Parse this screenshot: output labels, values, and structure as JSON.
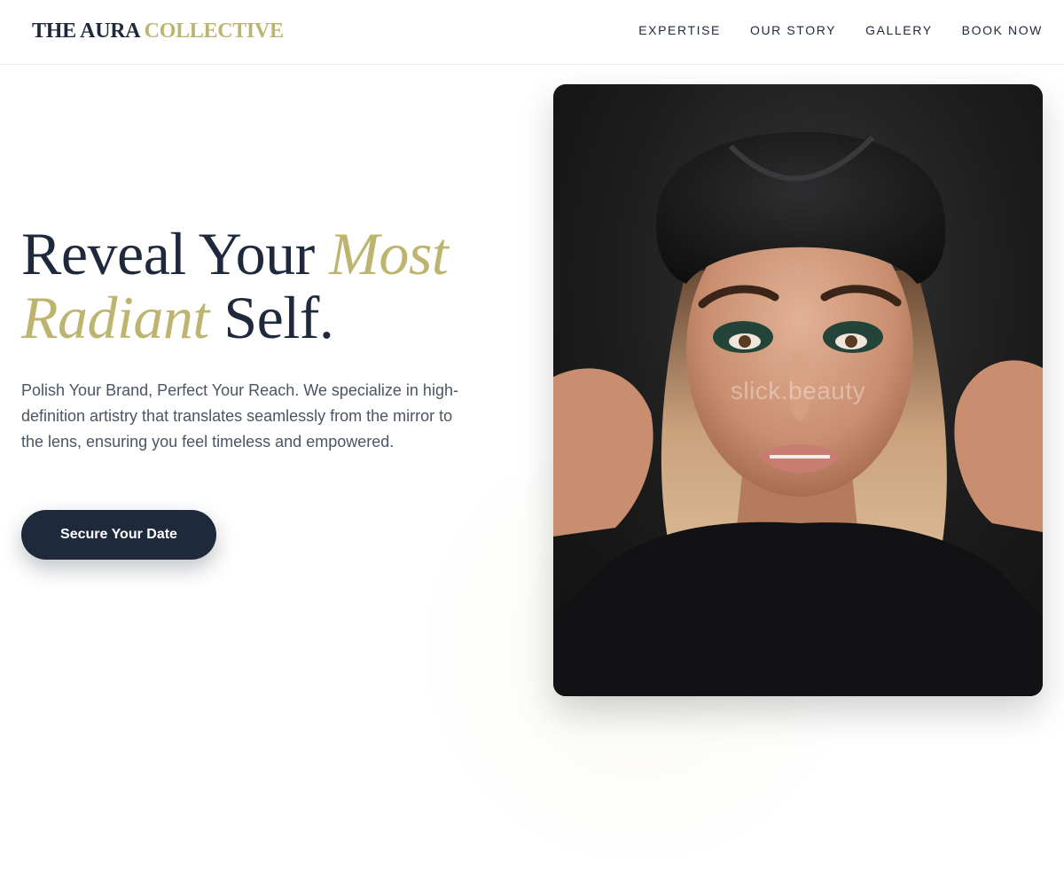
{
  "brand": {
    "name_primary": "THE AURA",
    "name_accent": "COLLECTIVE"
  },
  "nav": {
    "items": [
      {
        "label": "EXPERTISE"
      },
      {
        "label": "OUR STORY"
      },
      {
        "label": "GALLERY"
      },
      {
        "label": "BOOK NOW"
      }
    ]
  },
  "hero": {
    "headline_1": "Reveal Your",
    "headline_accent_1": "Most",
    "headline_accent_2": "Radiant",
    "headline_2": "Self.",
    "lead": "Polish Your Brand, Perfect Your Reach. We specialize in high-definition artistry that translates seamlessly from the mirror to the lens, ensuring you feel timeless and empowered.",
    "cta_label": "Secure Your Date"
  },
  "image": {
    "watermark": "slick.beauty"
  },
  "colors": {
    "primary": "#1e293b",
    "accent": "#bdb56f",
    "body_text": "#4b5563"
  }
}
